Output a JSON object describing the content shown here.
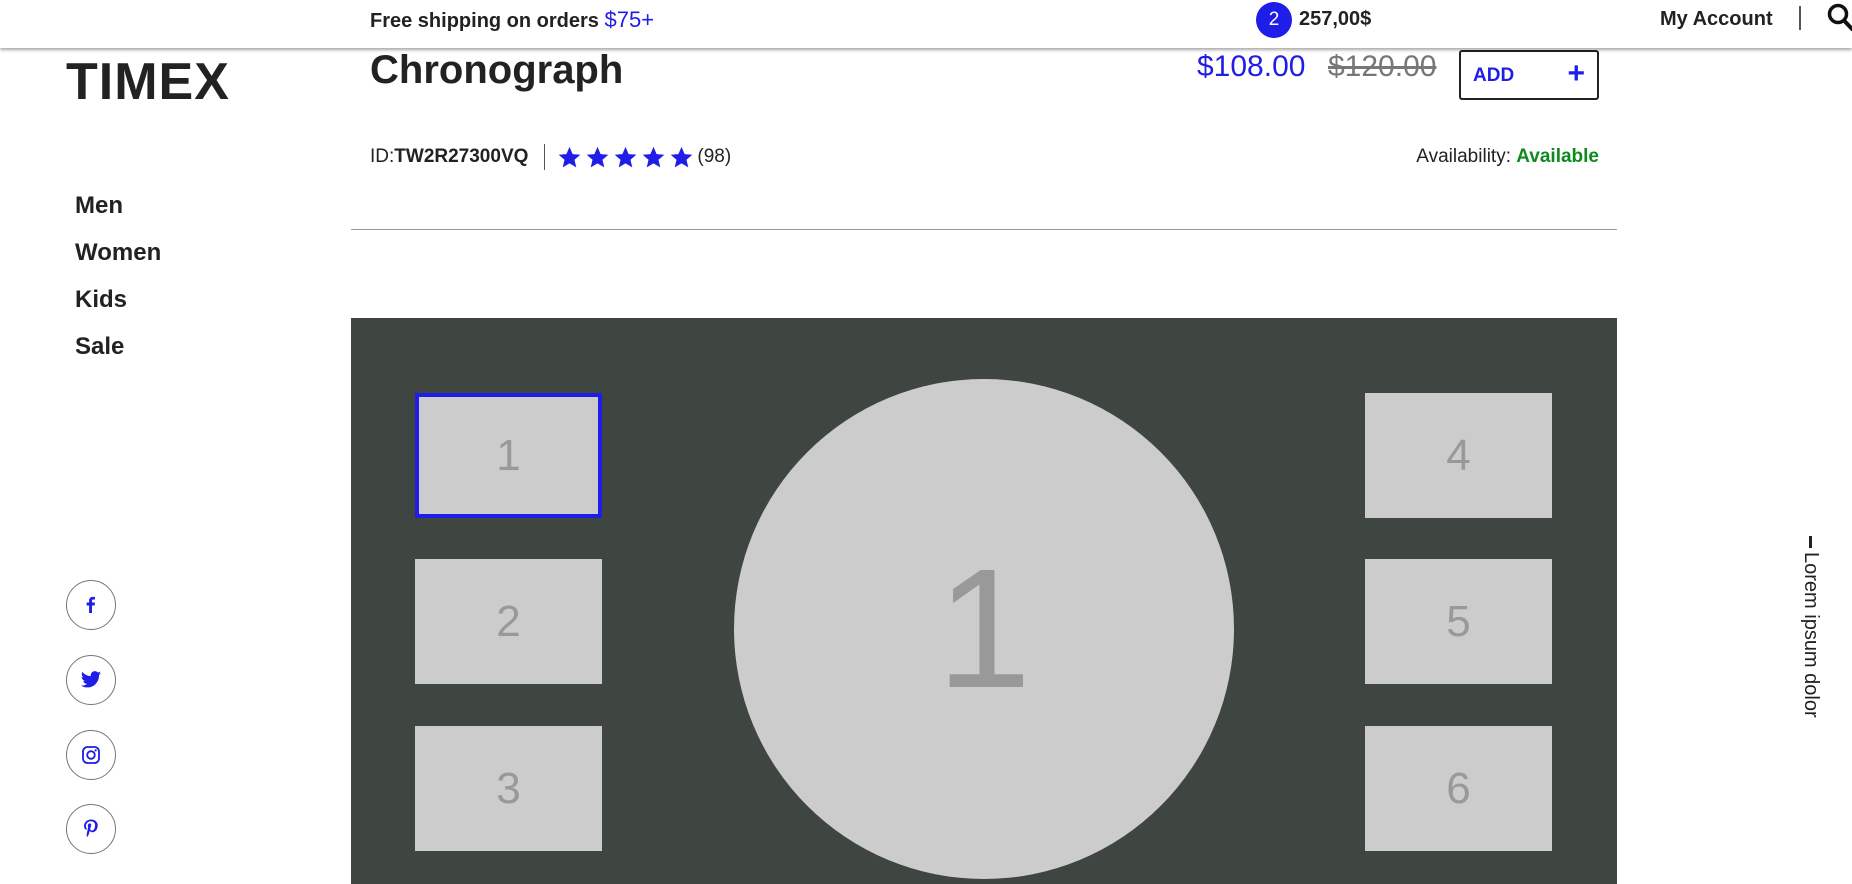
{
  "topbar": {
    "shipping_text": "Free shipping on orders",
    "shipping_amount": "$75+",
    "cart_count": "2",
    "cart_total": "257,00$",
    "account_label": "My Account",
    "search_icon": "search-icon"
  },
  "brand": {
    "logo": "TIMEX"
  },
  "nav": {
    "items": [
      "Men",
      "Women",
      "Kids",
      "Sale"
    ]
  },
  "social": [
    "facebook-icon",
    "twitter-icon",
    "instagram-icon",
    "pinterest-icon"
  ],
  "product": {
    "title": "Chronograph",
    "price": "$108.00",
    "old_price": "$120.00",
    "add_label": "ADD",
    "add_symbol": "+",
    "id_label": "ID:",
    "id_value": "TW2R27300VQ",
    "rating": 5,
    "reviews": "(98)",
    "availability_label": "Availability:",
    "availability_value": "Available"
  },
  "gallery": {
    "thumbnails": [
      "1",
      "2",
      "3",
      "4",
      "5",
      "6"
    ],
    "active_thumbnail": "1",
    "main_label": "1"
  },
  "side_text": "Lorem ipsum dolor",
  "colors": {
    "accent": "#1f1de8",
    "available": "#0f8a1f",
    "gallery_bg": "#3f4540",
    "placeholder": "#cccccc"
  }
}
